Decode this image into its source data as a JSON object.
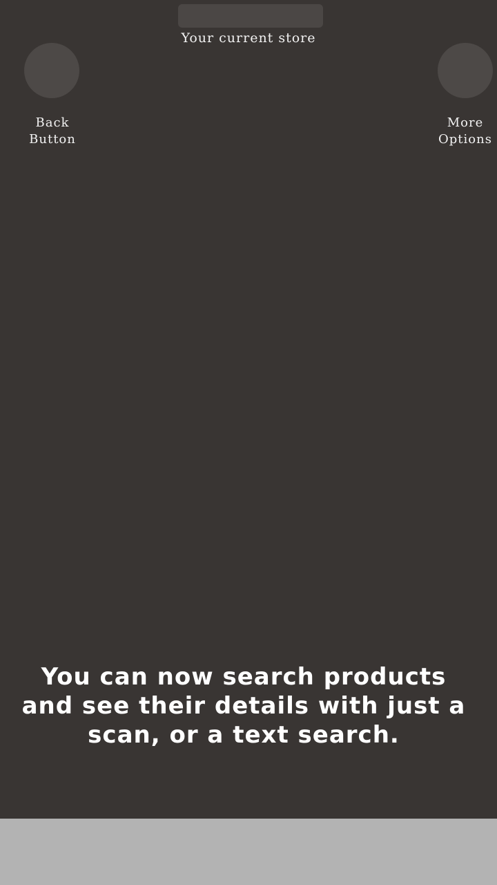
{
  "header": {
    "store_caption": "Your current store"
  },
  "hints": {
    "back_label_line1": "Back",
    "back_label_line2": "Button",
    "more_label_line1": "More",
    "more_label_line2": "Options"
  },
  "tip": {
    "message": "You can now search products and see their details with just a scan, or a text search."
  },
  "colors": {
    "overlay": "#393533",
    "highlight": "#4d4947",
    "text": "#ffffff",
    "bottom": "#b3b3b3"
  }
}
